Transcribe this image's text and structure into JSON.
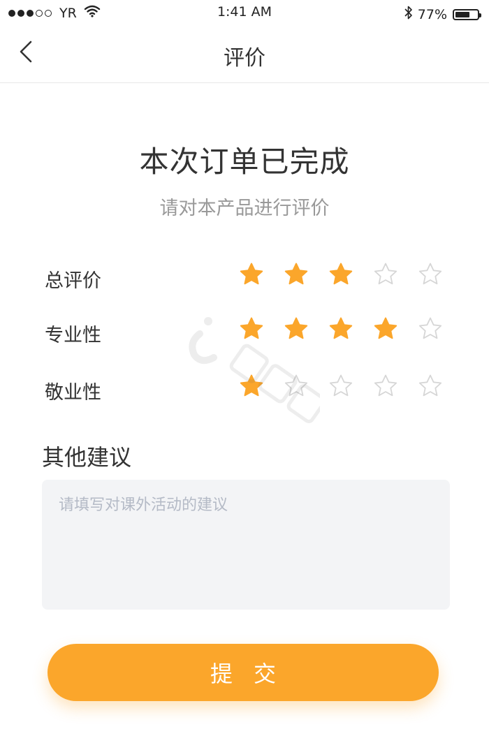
{
  "status_bar": {
    "carrier": "YR",
    "time": "1:41 AM",
    "battery": "77%",
    "battery_level": 0.77,
    "signal_bars": 3,
    "signal_total": 5
  },
  "nav": {
    "title": "评价"
  },
  "header": {
    "title": "本次订单已完成",
    "subtitle": "请对本产品进行评价"
  },
  "ratings": [
    {
      "label": "总评价",
      "value": 3,
      "max": 5
    },
    {
      "label": "专业性",
      "value": 4,
      "max": 5
    },
    {
      "label": "敬业性",
      "value": 1,
      "max": 5
    }
  ],
  "suggestion": {
    "title": "其他建议",
    "placeholder": "请填写对课外活动的建议",
    "value": ""
  },
  "submit": {
    "label": "提交"
  },
  "colors": {
    "star_filled": "#fba62b",
    "star_empty": "#d6d6d6",
    "button": "#fba62b"
  },
  "icons": {
    "back": "chevron-left-icon",
    "wifi": "wifi-icon",
    "bluetooth": "bluetooth-icon",
    "battery": "battery-icon",
    "star": "star-icon"
  }
}
